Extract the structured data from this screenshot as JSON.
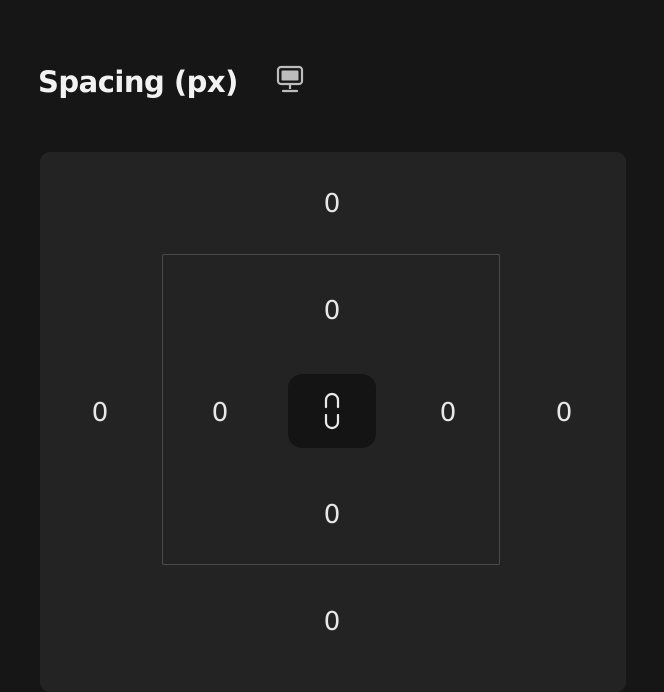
{
  "header": {
    "title": "Spacing (px)",
    "device_icon": "desktop-monitor-icon"
  },
  "margin": {
    "top": "0",
    "right": "0",
    "bottom": "0",
    "left": "0"
  },
  "padding": {
    "top": "0",
    "right": "0",
    "bottom": "0",
    "left": "0"
  },
  "link": {
    "icon": "link-icon"
  },
  "colors": {
    "background": "#161616",
    "panel": "#232323",
    "border": "#4a4a4a",
    "link_button": "#141414",
    "text": "#e8e8e8"
  }
}
